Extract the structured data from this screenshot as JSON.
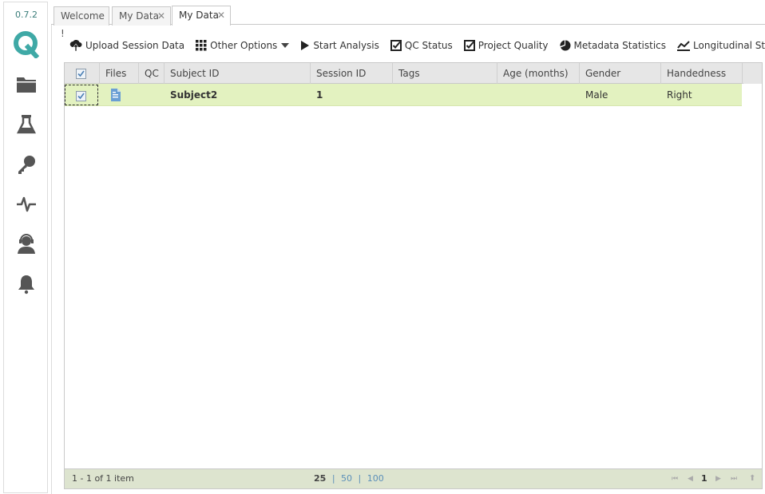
{
  "app": {
    "version": "0.7.2"
  },
  "sidebar": {
    "items": [
      {
        "icon": "folder-icon"
      },
      {
        "icon": "flask-icon"
      },
      {
        "icon": "key-icon"
      },
      {
        "icon": "pulse-icon"
      },
      {
        "icon": "support-person-icon"
      },
      {
        "icon": "bell-icon"
      }
    ]
  },
  "tabs": [
    {
      "label": "Welcome !",
      "closable": false,
      "active": false
    },
    {
      "label": "My Data",
      "closable": true,
      "active": false
    },
    {
      "label": "My Data",
      "closable": true,
      "active": true
    }
  ],
  "toolbar": {
    "upload": "Upload Session Data",
    "other_options": "Other Options",
    "start_analysis": "Start Analysis",
    "qc_status": "QC Status",
    "project_quality": "Project Quality",
    "metadata_statistics": "Metadata Statistics",
    "longitudinal_statistics": "Longitudinal Statist"
  },
  "grid": {
    "columns": [
      "Files",
      "QC",
      "Subject ID",
      "Session ID",
      "Tags",
      "Age (months)",
      "Gender",
      "Handedness"
    ],
    "rows": [
      {
        "checked": true,
        "subject_id": "Subject2",
        "session_id": "1",
        "tags": "",
        "age": "",
        "gender": "Male",
        "handedness": "Right"
      }
    ],
    "footer": {
      "summary": "1 - 1 of 1 item",
      "page_sizes": [
        "25",
        "50",
        "100"
      ],
      "current_page": "1"
    }
  },
  "colors": {
    "accent": "#3fa9a6",
    "row_selected": "#e3f2c0",
    "footer": "#dde4cf",
    "link": "#5b8fb9"
  }
}
